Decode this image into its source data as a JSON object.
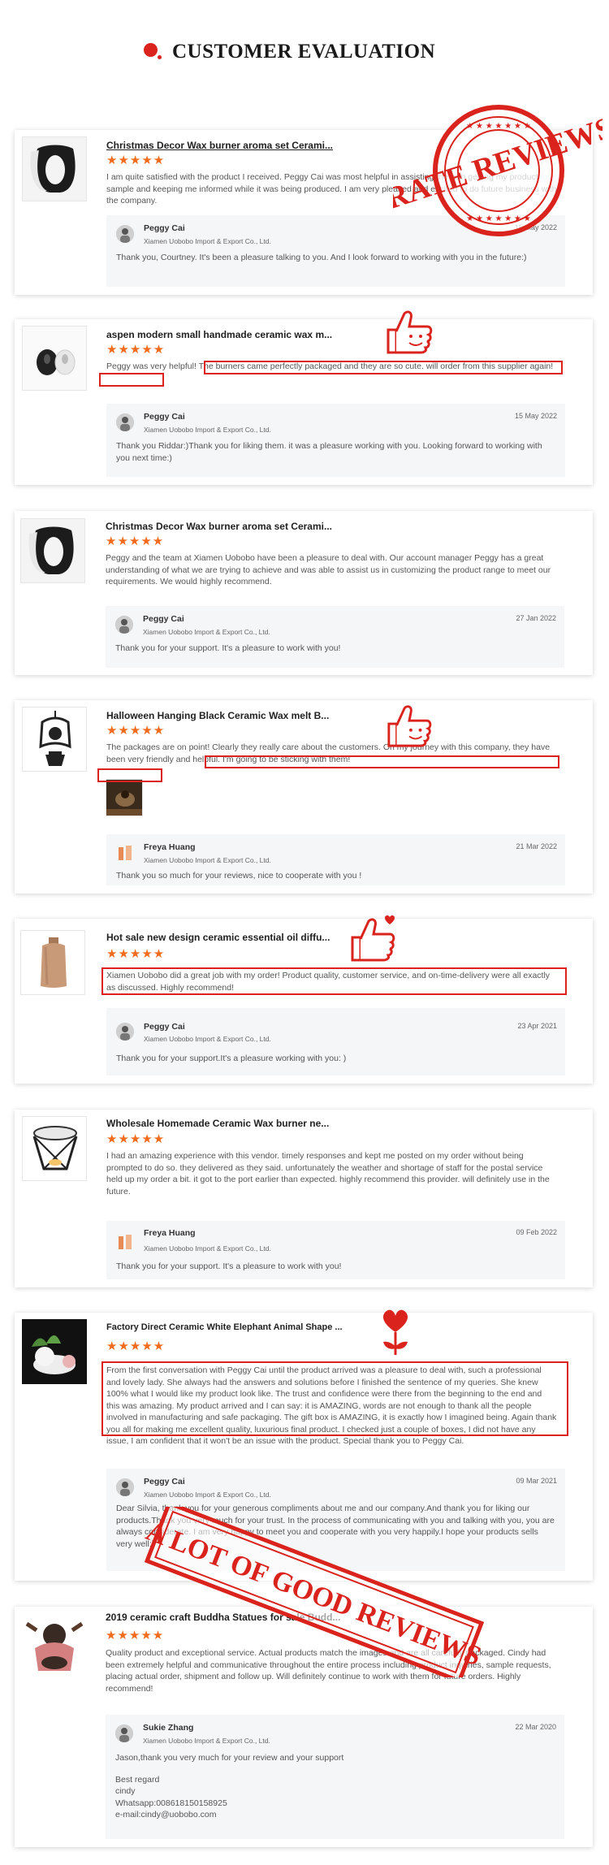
{
  "header": {
    "title": "CUSTOMER EVALUATION"
  },
  "colors": {
    "accent_red": "#d9231c",
    "star_orange": "#f26b1d",
    "reply_bg": "#f5f6f8"
  },
  "stamps": {
    "top": "RATE REVIEWS",
    "bottom": "A LOT OF GOOD REVIEWS"
  },
  "reviews": [
    {
      "title": "Christmas Decor Wax burner aroma set Cerami...",
      "stars": "★★★★★",
      "text": "I am quite satisfied with the product I received. Peggy Cai was most helpful in assisting me with getting my product sample and keeping me informed while it was being produced. I am very pleased and excited to do future business with the company.",
      "reply": {
        "name": "Peggy Cai",
        "company": "Xiamen Uobobo Import & Export Co., Ltd.",
        "date": "15 May 2022",
        "text": "Thank you, Courtney. It's been a pleasure talking to you. And I look forward to working with you in the future:)"
      }
    },
    {
      "title": "aspen modern small handmade ceramic wax m...",
      "stars": "★★★★★",
      "text": "Peggy was very helpful! The burners came perfectly packaged and they are so cute. will order from this supplier again!",
      "reply": {
        "name": "Peggy Cai",
        "company": "Xiamen Uobobo Import & Export Co., Ltd.",
        "date": "15 May 2022",
        "text": "Thank you Riddar:)Thank you for liking them. it was a pleasure working with you. Looking forward to working with you next time:)"
      }
    },
    {
      "title": "Christmas Decor Wax burner aroma set Cerami...",
      "stars": "★★★★★",
      "text": "Peggy and the team at Xiamen Uobobo have been a pleasure to deal with. Our account manager Peggy has a great understanding of what we are trying to achieve and was able to assist us in customizing the product range to meet our requirements. We would highly recommend.",
      "reply": {
        "name": "Peggy Cai",
        "company": "Xiamen Uobobo Import & Export Co., Ltd.",
        "date": "27 Jan 2022",
        "text": "Thank you for your support. It's a pleasure to work with you!"
      }
    },
    {
      "title": "Halloween Hanging Black Ceramic Wax melt B...",
      "stars": "★★★★★",
      "text": "The packages are on point! Clearly they really care about the customers. On my journey with this company, they have been very friendly and helpful. I'm going to be sticking with them!",
      "reply": {
        "name": "Freya Huang",
        "company": "Xiamen Uobobo Import & Export Co., Ltd.",
        "date": "21 Mar 2022",
        "text": "Thank you so much for your reviews, nice to cooperate with you !"
      }
    },
    {
      "title": "Hot sale new design ceramic essential oil diffu...",
      "stars": "★★★★★",
      "text": "Xiamen Uobobo did a great job with my order! Product quality, customer service, and on-time-delivery were all exactly as discussed. Highly recommend!",
      "reply": {
        "name": "Peggy Cai",
        "company": "Xiamen Uobobo Import & Export Co., Ltd.",
        "date": "23 Apr 2021",
        "text": "Thank you for your support.It's a pleasure working with you: )"
      }
    },
    {
      "title": "Wholesale Homemade Ceramic Wax burner ne...",
      "stars": "★★★★★",
      "text": "I had an amazing experience with this vendor. timely responses and kept me posted on my order without being prompted to do so. they delivered as they said. unfortunately the weather and shortage of staff for the postal service held up my order a bit. it got to the port earlier than expected. highly recommend this provider. will definitely use in the future.",
      "reply": {
        "name": "Freya Huang",
        "company": "Xiamen Uobobo Import & Export Co., Ltd.",
        "date": "09 Feb 2022",
        "text": "Thank you for your support. It's a pleasure to work with you!"
      }
    },
    {
      "title": "Factory Direct Ceramic White Elephant Animal Shape ...",
      "stars": "★★★★★",
      "text": "From the first conversation with Peggy Cai until the product arrived was a pleasure to deal with, such a professional and lovely lady. She always had the answers and solutions before I finished the sentence of my queries. She knew 100% what I would like my product look like. The trust and confidence were there from the beginning to the end and this was amazing. My product arrived and I can say: it is AMAZING, words are not enough to thank all the people involved in manufacturing and safe packaging. The gift box is AMAZING, it is exactly how I imagined being. Again thank you all for making me excellent quality, luxurious final product. I checked just a couple of boxes, I did not have any issue, I am confident that it won't be an issue with the product. Special thank you to Peggy Cai.",
      "reply": {
        "name": "Peggy Cai",
        "company": "Xiamen Uobobo Import & Export Co., Ltd.",
        "date": "09 Mar 2021",
        "text": "Dear Silvia, thank you for your generous compliments about me and our company.And thank you for liking our products.Thank you very much for your trust. In the process of communicating with you and talking with you, you are always considerate. I am very happy to meet you and cooperate with you very happily.I hope your products sells very well:)"
      }
    },
    {
      "title": "2019 ceramic craft Buddha Statues for sale Budd...",
      "stars": "★★★★★",
      "text": "Quality product and exceptional service. Actual products match the images and are all carefully packaged. Cindy had been extremely helpful and communicative throughout the entire process including product inquiries, sample requests, placing actual order, shipment and follow up. Will definitely continue to work with them for future orders. Highly recommend!",
      "reply": {
        "name": "Sukie Zhang",
        "company": "Xiamen Uobobo Import & Export Co., Ltd.",
        "date": "22 Mar 2020",
        "text": "Jason,thank you very much for your review and your  support",
        "signature": [
          "Best regard",
          "cindy",
          "Whatsapp:008618150158925",
          "e-mail:cindy@uobobo.com"
        ]
      }
    }
  ]
}
